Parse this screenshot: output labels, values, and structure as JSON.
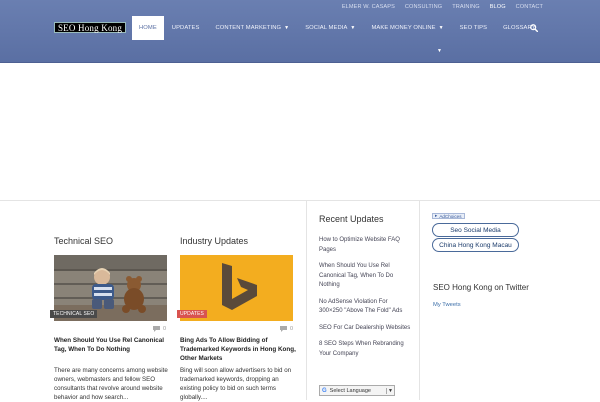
{
  "top_nav": [
    "ELMER W. CASAPS",
    "CONSULTING",
    "TRAINING",
    "BLOG",
    "CONTACT"
  ],
  "top_nav_active": "BLOG",
  "logo_text": "SEO Hong Kong",
  "main_nav": [
    {
      "label": "HOME",
      "active": true,
      "dropdown": false
    },
    {
      "label": "UPDATES",
      "active": false,
      "dropdown": false
    },
    {
      "label": "CONTENT MARKETING",
      "active": false,
      "dropdown": true
    },
    {
      "label": "SOCIAL MEDIA",
      "active": false,
      "dropdown": true
    },
    {
      "label": "MAKE MONEY ONLINE",
      "active": false,
      "dropdown": true
    },
    {
      "label": "SEO TIPS",
      "active": false,
      "dropdown": false
    },
    {
      "label": "GLOSSARY",
      "active": false,
      "dropdown": false
    }
  ],
  "colors": {
    "header": "#5a6fa3",
    "badge_red": "#d9534f",
    "link_blue": "#3b6ea8"
  },
  "technical": {
    "section_title": "Technical SEO",
    "badge": "TECHNICAL SEO",
    "comments": "0",
    "post_title": "When Should You Use Rel Canonical Tag, When To Do Nothing",
    "excerpt": "There are many concerns among website owners, webmasters and fellow SEO consultants that revolve around website behavior and how search..."
  },
  "industry": {
    "section_title": "Industry Updates",
    "badge": "UPDATES",
    "comments": "0",
    "post_title": "Bing Ads To Allow Bidding of Trademarked Keywords in Hong Kong, Other Markets",
    "excerpt": "Bing will soon allow advertisers to bid on trademarked keywords, dropping an existing policy to bid on such terms globally...."
  },
  "recent": {
    "title": "Recent Updates",
    "items": [
      "How to Optimize Website FAQ Pages",
      "When Should You Use Rel Canonical Tag, When To Do Nothing",
      "No AdSense Violation For 300×250 \"Above The Fold\" Ads",
      "SEO For Car Dealership Websites",
      "8 SEO Steps When Rebranding Your Company"
    ]
  },
  "language_select": {
    "value": "Select Language"
  },
  "ads": {
    "adchoices_label": "AdChoices",
    "buttons": [
      "Seo Social Media",
      "China Hong Kong Macau"
    ]
  },
  "twitter": {
    "title": "SEO Hong Kong on Twitter",
    "link": "My Tweets"
  }
}
